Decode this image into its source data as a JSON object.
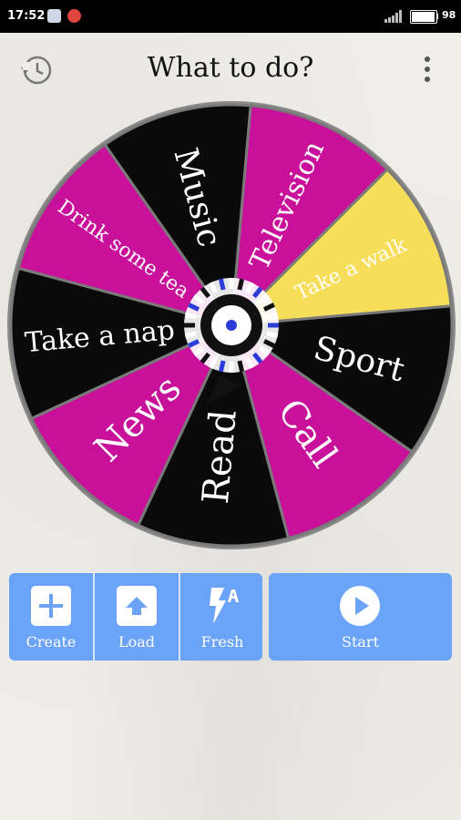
{
  "status_bar": {
    "time": "17:52",
    "battery": "98"
  },
  "header": {
    "title": "What to do?",
    "history_icon": "history-icon",
    "menu_icon": "more-vert-icon"
  },
  "wheel": {
    "segments": [
      {
        "label": "Television",
        "color": "#c8109a",
        "text_color": "#ffffff"
      },
      {
        "label": "Take a walk",
        "color": "#f7de5a",
        "text_color": "#ffffff"
      },
      {
        "label": "Sport",
        "color": "#0a0a0a",
        "text_color": "#ffffff"
      },
      {
        "label": "Call",
        "color": "#c8109a",
        "text_color": "#ffffff"
      },
      {
        "label": "Read",
        "color": "#0a0a0a",
        "text_color": "#ffffff"
      },
      {
        "label": "News",
        "color": "#c8109a",
        "text_color": "#ffffff"
      },
      {
        "label": "Take a nap",
        "color": "#0a0a0a",
        "text_color": "#ffffff"
      },
      {
        "label": "Drink some tea",
        "color": "#c8109a",
        "text_color": "#ffffff"
      },
      {
        "label": "Music",
        "color": "#0a0a0a",
        "text_color": "#ffffff"
      }
    ]
  },
  "toolbar": {
    "create_label": "Create",
    "load_label": "Load",
    "fresh_label": "Fresh",
    "start_label": "Start"
  },
  "colors": {
    "accent": "#6aa3f7",
    "magenta": "#c8109a",
    "yellow": "#f7de5a",
    "black": "#0a0a0a"
  }
}
